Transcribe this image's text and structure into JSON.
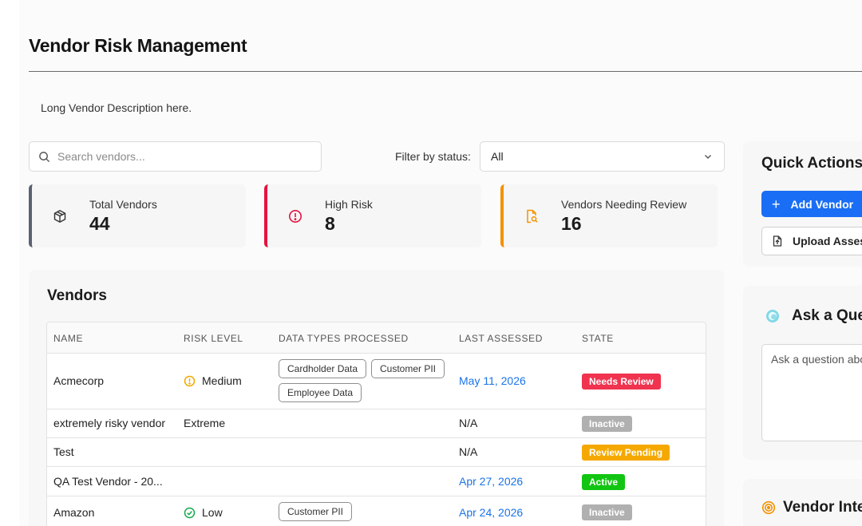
{
  "page": {
    "title": "Vendor Risk Management",
    "description": "Long Vendor Description here."
  },
  "search": {
    "placeholder": "Search vendors...",
    "value": ""
  },
  "filter": {
    "label": "Filter by status:",
    "selected": "All"
  },
  "stats": [
    {
      "label": "Total Vendors",
      "value": "44",
      "icon": "box-icon",
      "accent": "#5a6272"
    },
    {
      "label": "High Risk",
      "value": "8",
      "icon": "alert-circle-icon",
      "accent": "#e5133f"
    },
    {
      "label": "Vendors Needing Review",
      "value": "16",
      "icon": "file-search-icon",
      "accent": "#f39200"
    }
  ],
  "vendors": {
    "title": "Vendors",
    "columns": [
      "NAME",
      "RISK LEVEL",
      "DATA TYPES PROCESSED",
      "LAST ASSESSED",
      "STATE"
    ],
    "rows": [
      {
        "name": "Acmecorp",
        "risk": "Medium",
        "risk_icon": "alert-circle-icon",
        "data_types": [
          "Cardholder Data",
          "Customer PII",
          "Employee Data"
        ],
        "last_assessed": "May 11, 2026",
        "state": "Needs Review",
        "state_color": "#f0334f"
      },
      {
        "name": "extremely risky vendor",
        "risk": "Extreme",
        "risk_icon": "",
        "data_types": [],
        "last_assessed": "N/A",
        "state": "Inactive",
        "state_color": "#b0b0b0"
      },
      {
        "name": "Test",
        "risk": "",
        "risk_icon": "",
        "data_types": [],
        "last_assessed": "N/A",
        "state": "Review Pending",
        "state_color": "#f5a800"
      },
      {
        "name": "QA Test Vendor - 20...",
        "risk": "",
        "risk_icon": "",
        "data_types": [],
        "last_assessed": "Apr 27, 2026",
        "state": "Active",
        "state_color": "#12c512"
      },
      {
        "name": "Amazon",
        "risk": "Low",
        "risk_icon": "check-circle-icon",
        "data_types": [
          "Customer PII"
        ],
        "last_assessed": "Apr 24, 2026",
        "state": "Inactive",
        "state_color": "#b0b0b0"
      }
    ]
  },
  "quick_actions": {
    "title": "Quick Actions",
    "add_vendor": "Add Vendor",
    "upload_assessment": "Upload Asses"
  },
  "ask": {
    "title": "Ask a Que",
    "placeholder": "Ask a question abo"
  },
  "vendor_intel": {
    "title": "Vendor Inte"
  },
  "colors": {
    "primary": "#1a6ef5",
    "link": "#1a73e8",
    "medium": "#f0a800",
    "low": "#17a94a"
  }
}
